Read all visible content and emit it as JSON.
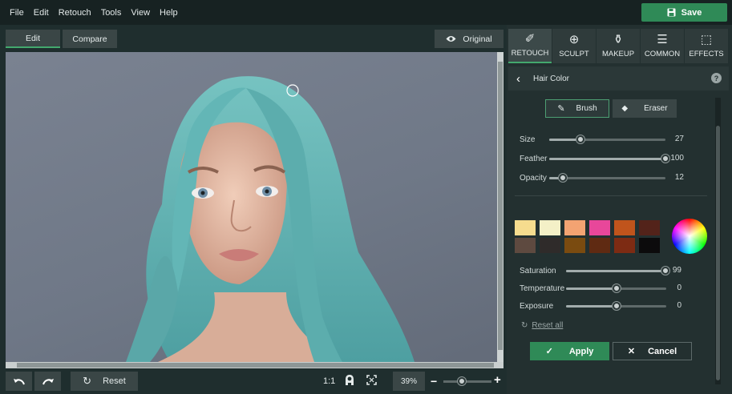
{
  "menu": [
    "File",
    "Edit",
    "Retouch",
    "Tools",
    "View",
    "Help"
  ],
  "save_label": "Save",
  "view_tabs": {
    "edit": "Edit",
    "compare": "Compare",
    "original": "Original"
  },
  "bottom": {
    "reset": "Reset",
    "ratio": "1:1",
    "zoom": "39%",
    "zoom_level": 0.38
  },
  "panel_tabs": [
    {
      "label": "RETOUCH",
      "icon": "retouch-brush-icon"
    },
    {
      "label": "SCULPT",
      "icon": "sculpt-crosshair-icon"
    },
    {
      "label": "MAKEUP",
      "icon": "makeup-bottles-icon"
    },
    {
      "label": "COMMON",
      "icon": "sliders-icon"
    },
    {
      "label": "EFFECTS",
      "icon": "effects-cursor-icon"
    }
  ],
  "section_title": "Hair Color",
  "tools": {
    "brush": "Brush",
    "eraser": "Eraser"
  },
  "brush_sliders": [
    {
      "label": "Size",
      "value": "27",
      "level": 0.27
    },
    {
      "label": "Feather",
      "value": "100",
      "level": 1.0
    },
    {
      "label": "Opacity",
      "value": "12",
      "level": 0.12
    }
  ],
  "swatches_row1": [
    "#f6dc8e",
    "#f4f0c7",
    "#f3a372",
    "#e8479a",
    "#c0541c",
    "#53231a"
  ],
  "swatches_row2": [
    "#5e4a40",
    "#2f2b2a",
    "#7a4b10",
    "#5f2a12",
    "#7d2b13",
    "#0c0b0c"
  ],
  "color_sliders": [
    {
      "label": "Saturation",
      "value": "99",
      "level": 0.99
    },
    {
      "label": "Temperature",
      "value": "0",
      "level": 0.5
    },
    {
      "label": "Exposure",
      "value": "0",
      "level": 0.5
    }
  ],
  "reset_all": "Reset all",
  "apply": "Apply",
  "cancel": "Cancel"
}
